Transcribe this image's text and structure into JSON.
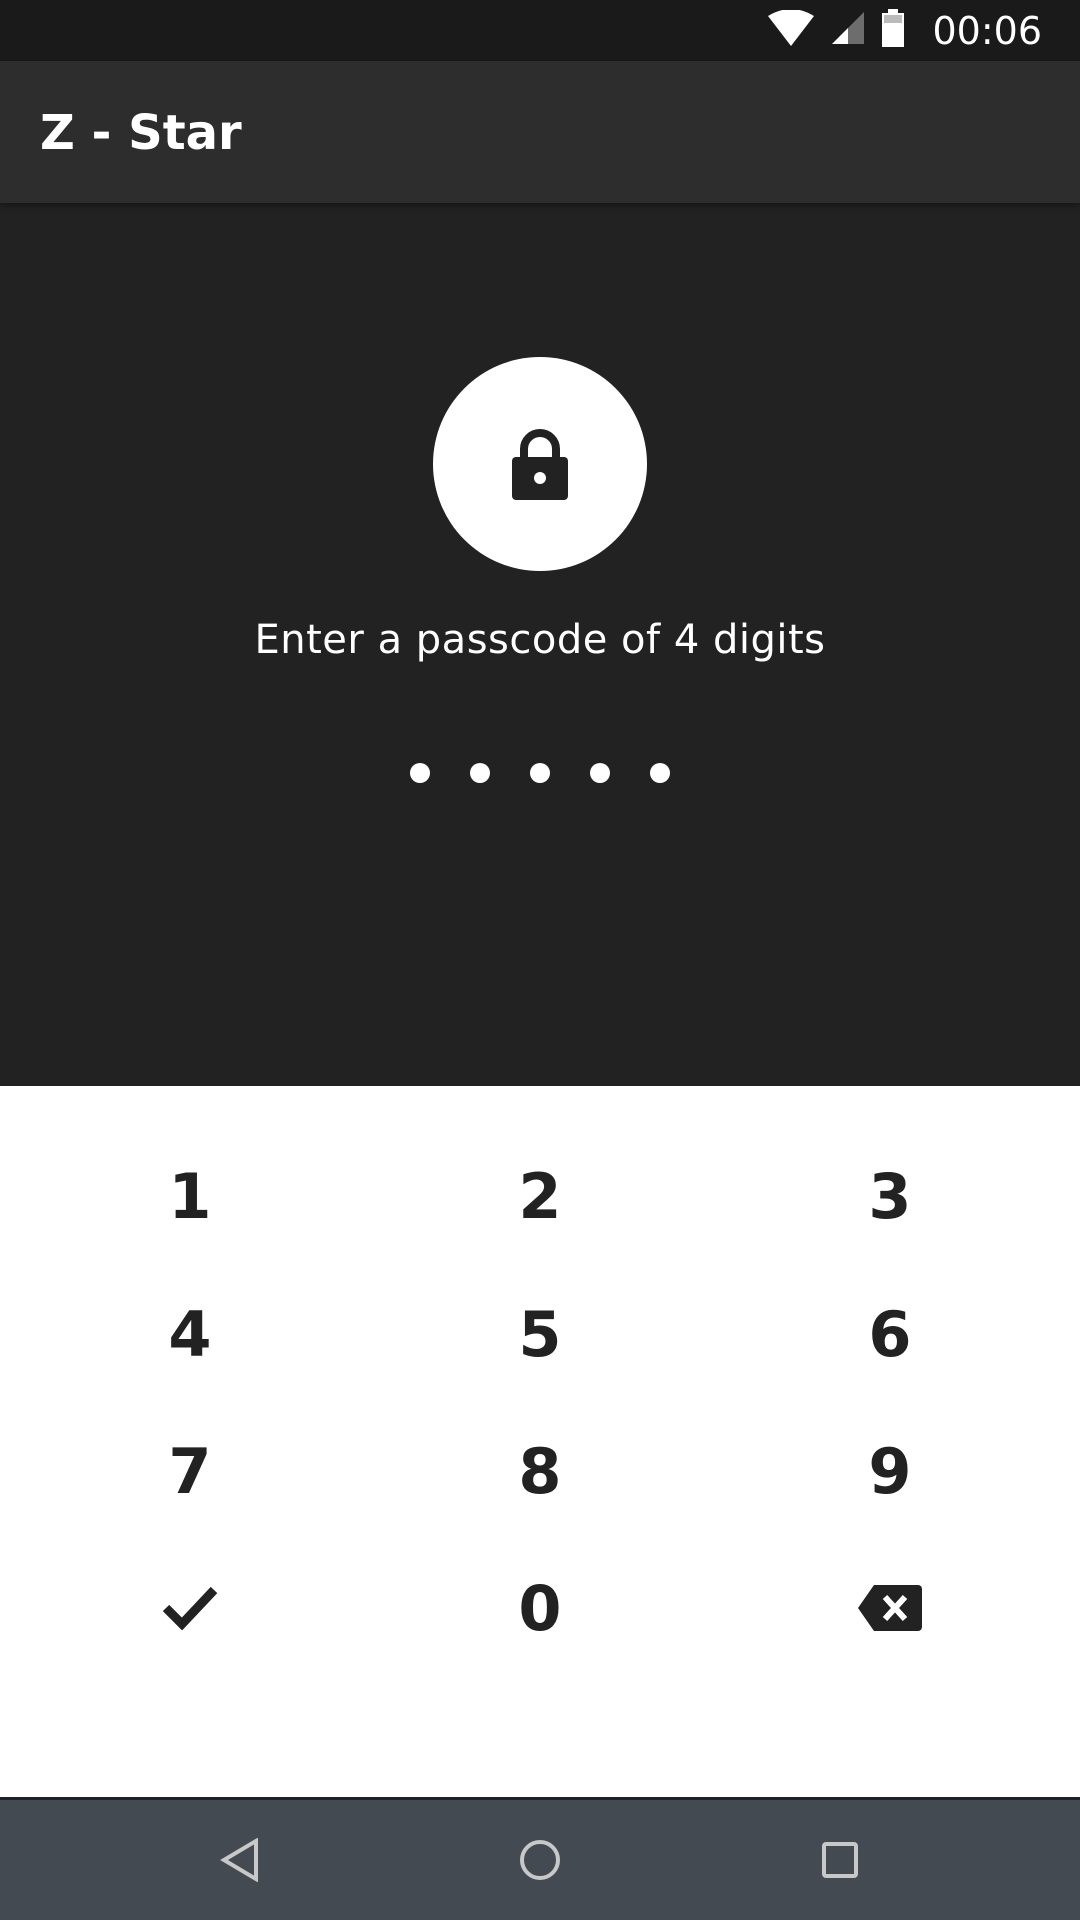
{
  "status_bar": {
    "time": "00:06",
    "icons": [
      "wifi-icon",
      "cellular-signal-icon",
      "battery-icon"
    ]
  },
  "app_bar": {
    "title": "Z - Star"
  },
  "lock": {
    "icon": "lock-icon"
  },
  "prompt": "Enter a passcode of 4 digits",
  "passcode_dots_count": 5,
  "keypad": {
    "keys": [
      "1",
      "2",
      "3",
      "4",
      "5",
      "6",
      "7",
      "8",
      "9",
      "0"
    ],
    "confirm_icon": "check-icon",
    "delete_icon": "backspace-icon"
  },
  "nav_bar": {
    "icons": [
      "back-icon",
      "home-icon",
      "recents-icon"
    ]
  },
  "colors": {
    "background": "#222222",
    "app_bar": "#2d2d2d",
    "keypad": "#ffffff",
    "wave_gray": "#8e8e8e",
    "nav_bar": "#444a51"
  }
}
